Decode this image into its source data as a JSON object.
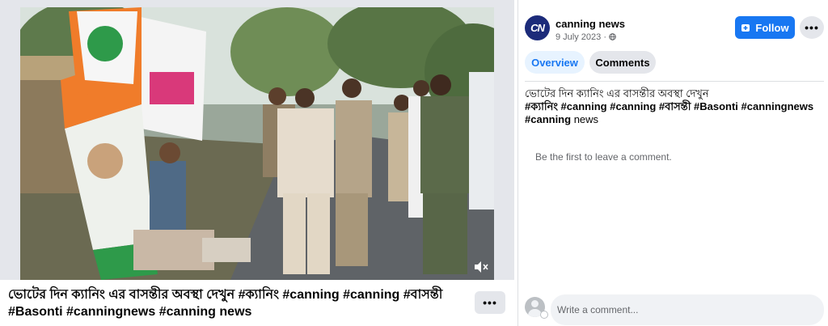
{
  "video": {
    "caption": "ভোটের দিন ক্যানিং এর বাসন্তীর অবস্থা দেখুন #ক্যানিং #canning #canning #বাসন্তী #Basonti #canningnews #canning news",
    "mute_icon": "speaker-muted-icon",
    "more_icon": "more-horizontal-icon",
    "more_label": "•••"
  },
  "post": {
    "page_name": "canning news",
    "avatar_text": "CN",
    "date": "9 July 2023",
    "audience_icon": "globe-icon",
    "follow_label": "Follow",
    "follow_icon": "follow-page-icon",
    "more_label": "•••",
    "text_line": "ভোটের দিন ক্যানিং এর বাসন্তীর অবস্থা দেখুন",
    "tags_line": "#ক্যানিং #canning #canning #বাসন্তী #Basonti #canningnews",
    "tags_line2_tag": "#canning",
    "tags_line2_word": "news"
  },
  "tabs": [
    {
      "label": "Overview",
      "active": true
    },
    {
      "label": "Comments",
      "active": false
    }
  ],
  "comments": {
    "empty_text": "Be the first to leave a comment.",
    "input_placeholder": "Write a comment..."
  },
  "colors": {
    "accent": "#1877f2",
    "tab_active_bg": "#e7f3ff",
    "page_avatar": "#1c2b7a"
  }
}
